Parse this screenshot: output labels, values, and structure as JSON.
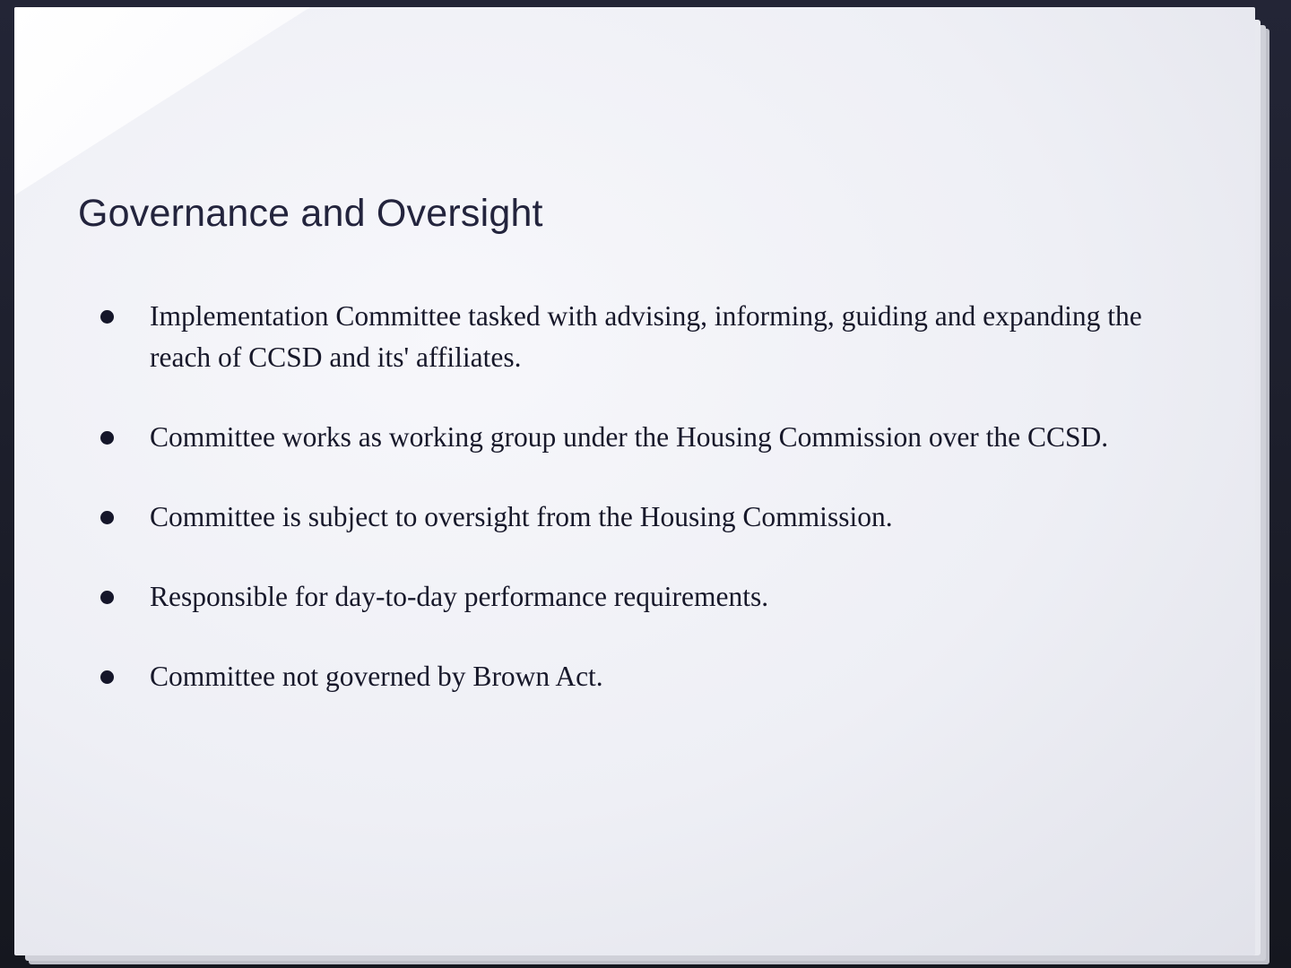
{
  "slide": {
    "title": "Governance and Oversight",
    "bullets": [
      {
        "text": "Implementation Committee tasked with advising, informing, guiding and expanding the reach of CCSD and its' affiliates."
      },
      {
        "text": "Committee works as working group under the Housing Commission over the CCSD."
      },
      {
        "text": "Committee is subject to oversight from the Housing Commission."
      },
      {
        "text": "Responsible for day-to-day performance requirements."
      },
      {
        "text": "Committee not governed by Brown Act."
      }
    ]
  }
}
